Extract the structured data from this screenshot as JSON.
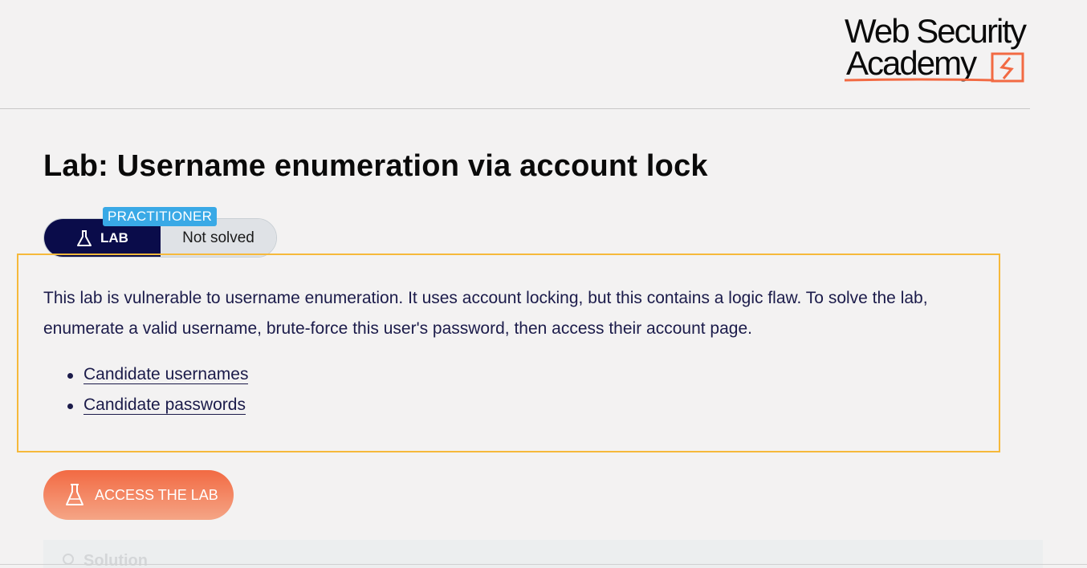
{
  "header": {
    "logo_line1": "Web Security",
    "logo_line2": "Academy"
  },
  "lab": {
    "title": "Lab: Username enumeration via account lock",
    "level": "PRACTITIONER",
    "badge_label": "LAB",
    "status": "Not solved",
    "description": "This lab is vulnerable to username enumeration. It uses account locking, but this contains a logic flaw. To solve the lab, enumerate a valid username, brute-force this user's password, then access their account page.",
    "links": [
      {
        "label": "Candidate usernames"
      },
      {
        "label": "Candidate passwords"
      }
    ],
    "access_button": "ACCESS THE LAB",
    "solution_label": "Solution"
  },
  "colors": {
    "accent_orange": "#f26a43",
    "navy": "#0a0c4a",
    "practitioner_blue": "#39a9e6",
    "highlight_border": "#f6b93b"
  },
  "icons": {
    "flask": "flask-icon",
    "logo_mark": "burp-lightning-icon"
  }
}
